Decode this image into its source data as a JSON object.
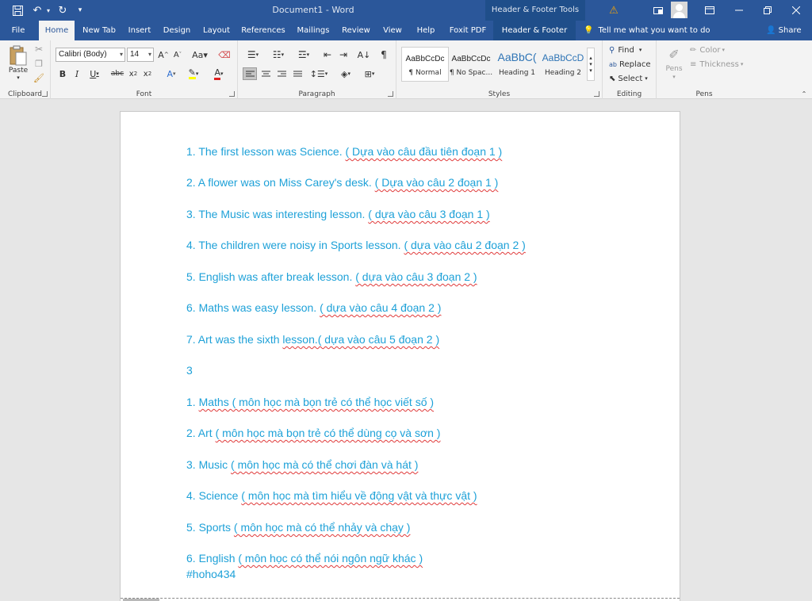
{
  "title_bar": {
    "doc_title": "Document1  -  Word",
    "contextual_title": "Header & Footer Tools",
    "warning_glyph": "⚠",
    "colors": {
      "title_bar": "#2b579a",
      "contextual": "#1f4e8a",
      "warning": "#f0a30a"
    }
  },
  "tabs": [
    "File",
    "Home",
    "New Tab",
    "Insert",
    "Design",
    "Layout",
    "References",
    "Mailings",
    "Review",
    "View",
    "Help",
    "Foxit PDF",
    "Header & Footer"
  ],
  "tell_me": "Tell me what you want to do",
  "share": "Share",
  "ribbon": {
    "clipboard": {
      "label": "Clipboard",
      "paste": "Paste"
    },
    "font": {
      "label": "Font",
      "name": "Calibri (Body)",
      "size": "14"
    },
    "paragraph": {
      "label": "Paragraph"
    },
    "styles": {
      "label": "Styles",
      "items": [
        {
          "sample": "AaBbCcDc",
          "name": "¶ Normal"
        },
        {
          "sample": "AaBbCcDc",
          "name": "¶ No Spac..."
        },
        {
          "sample": "AaBbC(",
          "name": "Heading 1"
        },
        {
          "sample": "AaBbCcD",
          "name": "Heading 2"
        }
      ]
    },
    "editing": {
      "label": "Editing",
      "find": "Find",
      "replace": "Replace",
      "select": "Select"
    },
    "pens": {
      "label": "Pens",
      "pens": "Pens",
      "color": "Color",
      "thickness": "Thickness"
    }
  },
  "document": {
    "text_color": "#1ea1d8",
    "lines": [
      {
        "plain": "1. The first lesson was Science. ",
        "note": "( Dựa vào câu đầu tiên đoạn 1 )"
      },
      {
        "plain": "2. A flower was on Miss Carey's desk. ",
        "note": "( Dựa vào câu 2 đoạn 1 )"
      },
      {
        "plain": "3. The Music was interesting lesson. ",
        "note": "( dựa vào câu 3 đoạn 1 )"
      },
      {
        "plain": "4. The children were noisy in Sports lesson. ",
        "note": "( dựa vào câu 2 đoạn 2 )"
      },
      {
        "plain": "5. English was after break lesson. ",
        "note": "( dựa vào câu 3 đoạn 2 )"
      },
      {
        "plain": "6. Maths was easy lesson. ",
        "note": "( dựa vào câu 4 đoạn 2 )"
      },
      {
        "plain": "7. Art was the sixth ",
        "note": "lesson.( dựa vào câu 5 đoạn 2 )"
      },
      {
        "plain": "3",
        "note": ""
      },
      {
        "plain": "1. ",
        "note": "Maths ( môn học mà bọn trẻ có thể học viết số )"
      },
      {
        "plain": "2. Art ",
        "note": "( môn học mà bọn trẻ có thể dùng cọ và sơn )"
      },
      {
        "plain": "3. Music ",
        "note": "( môn học mà có thể chơi đàn và hát )"
      },
      {
        "plain": "4. Science ",
        "note": "( môn học mà tìm hiểu về động vật và thực vật )"
      },
      {
        "plain": "5. Sports ",
        "note": "( môn học mà có thể nhảy và chạy )"
      },
      {
        "plain": "6. English ",
        "note": "( môn học có thể nói ngôn ngữ khác )"
      }
    ],
    "hashtag": "#hoho434"
  }
}
